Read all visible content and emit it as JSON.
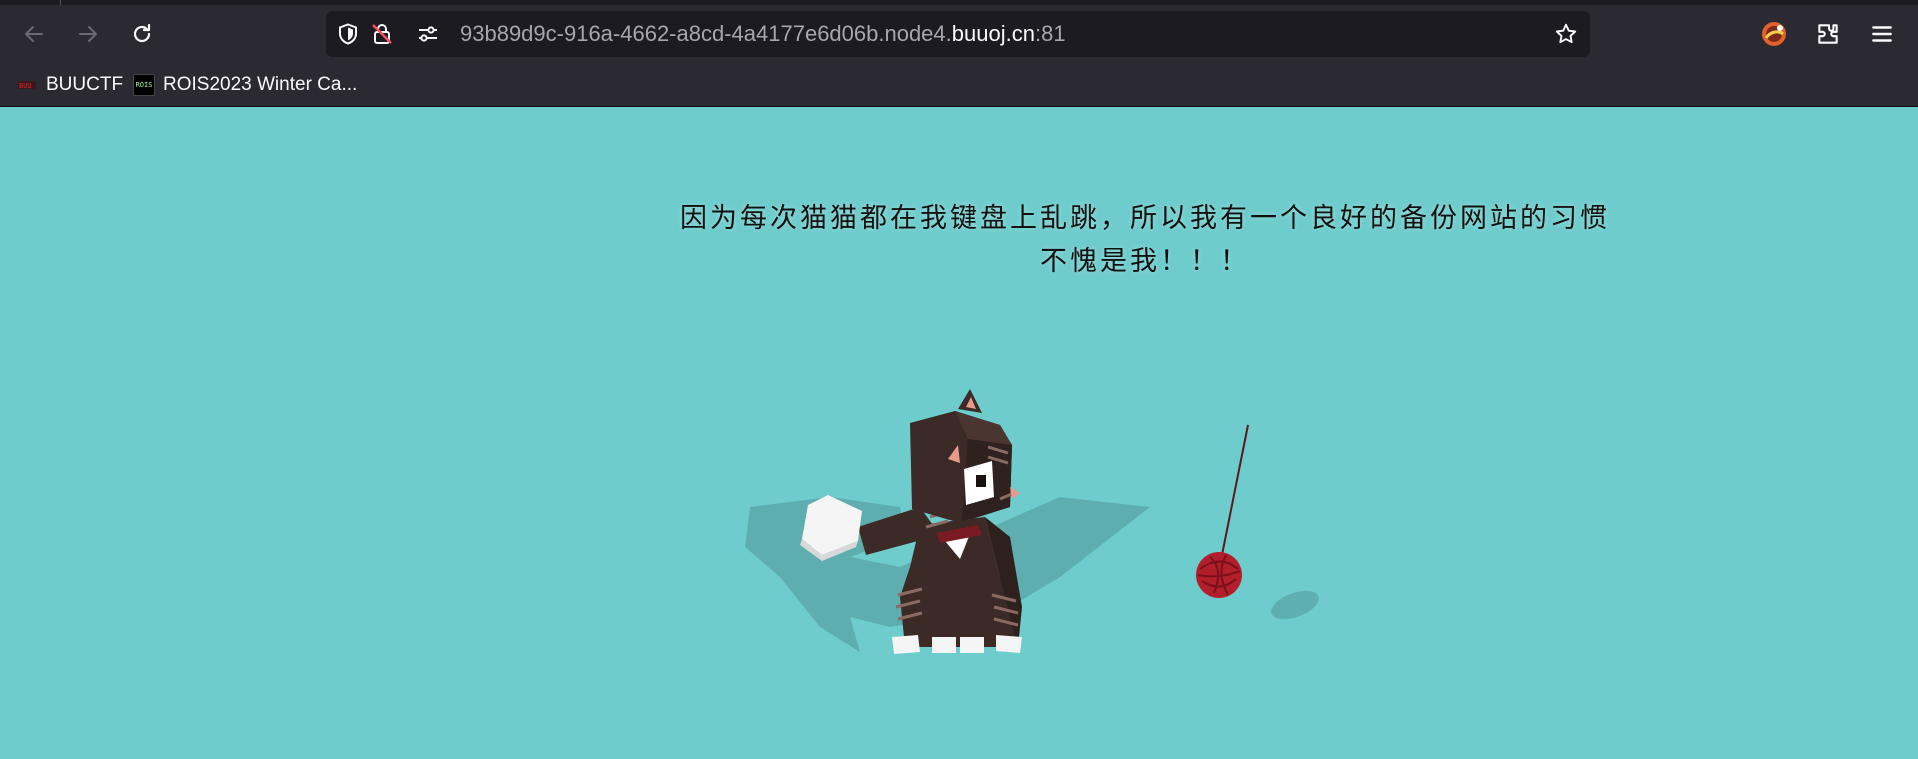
{
  "browser": {
    "url_prefix": "93b89d9c-916a-4662-a8cd-4a4177e6d06b.node4.",
    "url_domain": "buuoj.cn",
    "url_port": ":81",
    "bookmarks": [
      {
        "label": "BUUCTF",
        "icon": "buuctf-favicon"
      },
      {
        "label": "ROIS2023 Winter Ca...",
        "icon": "rois-favicon",
        "icon_text": "ROIS"
      }
    ]
  },
  "page": {
    "message_line1": "因为每次猫猫都在我键盘上乱跳，所以我有一个良好的备份网站的习惯",
    "message_line2": "不愧是我！！！",
    "background_color": "#6ecccc"
  },
  "colors": {
    "chrome_bg": "#2b2a33",
    "urlbar_bg": "#1c1b22",
    "cat_body": "#3b2a26",
    "yarn": "#b21e2a"
  }
}
